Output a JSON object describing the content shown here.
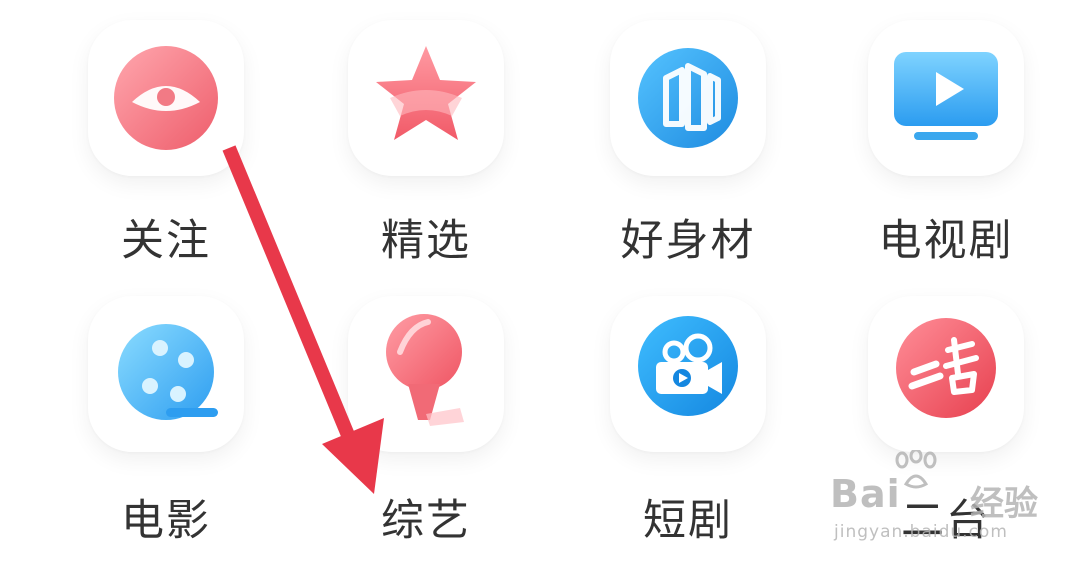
{
  "grid": {
    "items": [
      {
        "label": "关注",
        "icon": "eye-icon"
      },
      {
        "label": "精选",
        "icon": "star-icon"
      },
      {
        "label": "好身材",
        "icon": "fitness-logo-icon"
      },
      {
        "label": "电视剧",
        "icon": "tv-play-icon"
      },
      {
        "label": "电影",
        "icon": "film-reel-icon"
      },
      {
        "label": "综艺",
        "icon": "microphone-icon"
      },
      {
        "label": "短剧",
        "icon": "video-camera-icon"
      },
      {
        "label": "二台",
        "icon": "channel-two-icon"
      }
    ]
  },
  "annotation": {
    "color": "#e8384a"
  },
  "watermark": {
    "brand": "Bai",
    "cn": "经验",
    "url": "jingyan.baidu.com"
  },
  "colors": {
    "pink": "#f47c86",
    "blue": "#3aa7ee",
    "text": "#333333"
  }
}
